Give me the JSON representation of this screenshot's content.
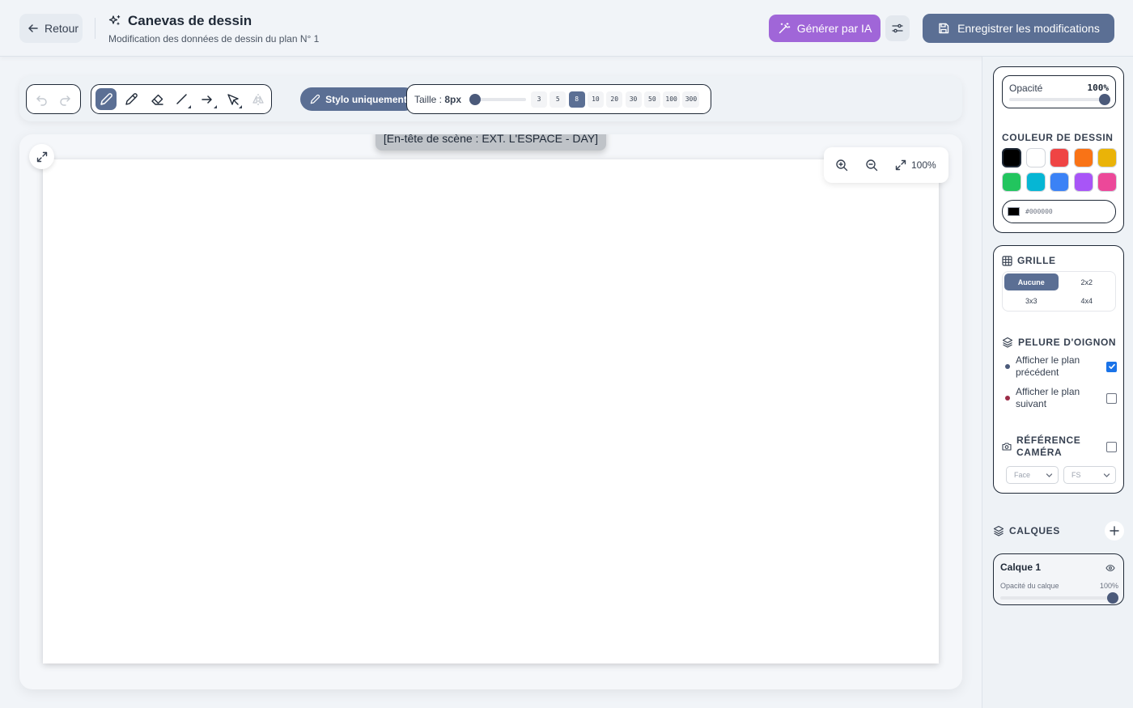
{
  "header": {
    "back_label": "Retour",
    "title": "Canevas de dessin",
    "subtitle": "Modification des données de dessin du plan N° 1",
    "ai_button_label": "Générer par IA",
    "save_button_label": "Enregistrer les modifications",
    "icons": [
      "arrow-left-icon",
      "sparkles-icon",
      "wand-icon",
      "sliders-icon",
      "save-icon"
    ]
  },
  "toolbar": {
    "tools": [
      "pen",
      "pencil",
      "eraser",
      "line",
      "arrow",
      "select",
      "mirror"
    ],
    "active_tool": "pen",
    "pen_only_label": "Stylo uniquement",
    "size_label_prefix": "Taille : ",
    "size_value": "8px",
    "size_presets": [
      "3",
      "5",
      "8",
      "10",
      "20",
      "30",
      "50",
      "100",
      "300"
    ],
    "active_size": "8"
  },
  "canvas": {
    "scene_header": "[En-tête de scène : EXT. L'ESPACE - DAY]",
    "zoom_level": "100%"
  },
  "panel": {
    "opacity_label": "Opacité",
    "opacity_value": "100%",
    "color_section_title": "COULEUR DE DESSIN",
    "swatches": [
      "#000000",
      "#ffffff",
      "#ef4444",
      "#f97316",
      "#eab308",
      "#22c55e",
      "#06b6d4",
      "#3b82f6",
      "#a855f7",
      "#ec4899"
    ],
    "active_swatch": "#000000",
    "hex_value": "#000000",
    "grid_title": "GRILLE",
    "grid_options": [
      "Aucune",
      "2x2",
      "3x3",
      "4x4"
    ],
    "active_grid": "Aucune",
    "onion_title": "PELURE D'OIGNON",
    "onion_prev": "Afficher le plan précédent",
    "onion_prev_checked": true,
    "onion_next": "Afficher le plan suivant",
    "onion_next_checked": false,
    "camera_label_1": "RÉFÉRENCE",
    "camera_label_2": "CAMÉRA",
    "camera_checked": false,
    "camera_angle": "Face",
    "camera_shot": "FS",
    "layers_title": "CALQUES",
    "layer_name": "Calque 1",
    "layer_opacity_label": "Opacité du calque",
    "layer_opacity_value": "100%"
  }
}
